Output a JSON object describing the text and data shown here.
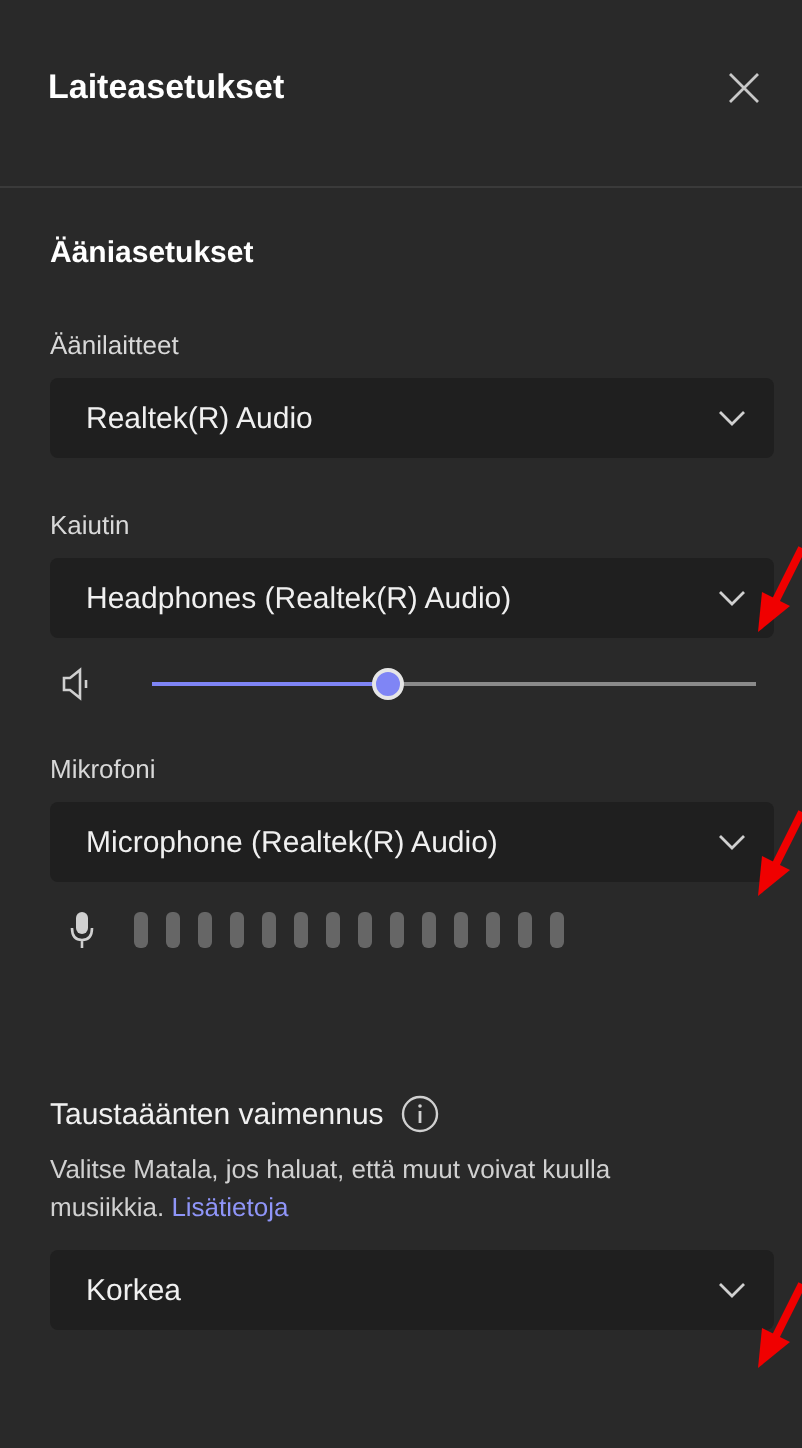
{
  "window": {
    "title": "Laiteasetukset"
  },
  "section": {
    "title": "Ääniasetukset"
  },
  "audio_device": {
    "label": "Äänilaitteet",
    "value": "Realtek(R) Audio"
  },
  "speaker": {
    "label": "Kaiutin",
    "value": "Headphones (Realtek(R) Audio)",
    "volume": {
      "level": 0.39
    }
  },
  "microphone": {
    "label": "Mikrofoni",
    "value": "Microphone (Realtek(R) Audio)"
  },
  "noise_suppression": {
    "label": "Taustaäänten vaimennus",
    "description": "Valitse Matala, jos haluat, että muut voivat kuulla musiikkia.",
    "link": "Lisätietoja",
    "value": "Korkea"
  }
}
